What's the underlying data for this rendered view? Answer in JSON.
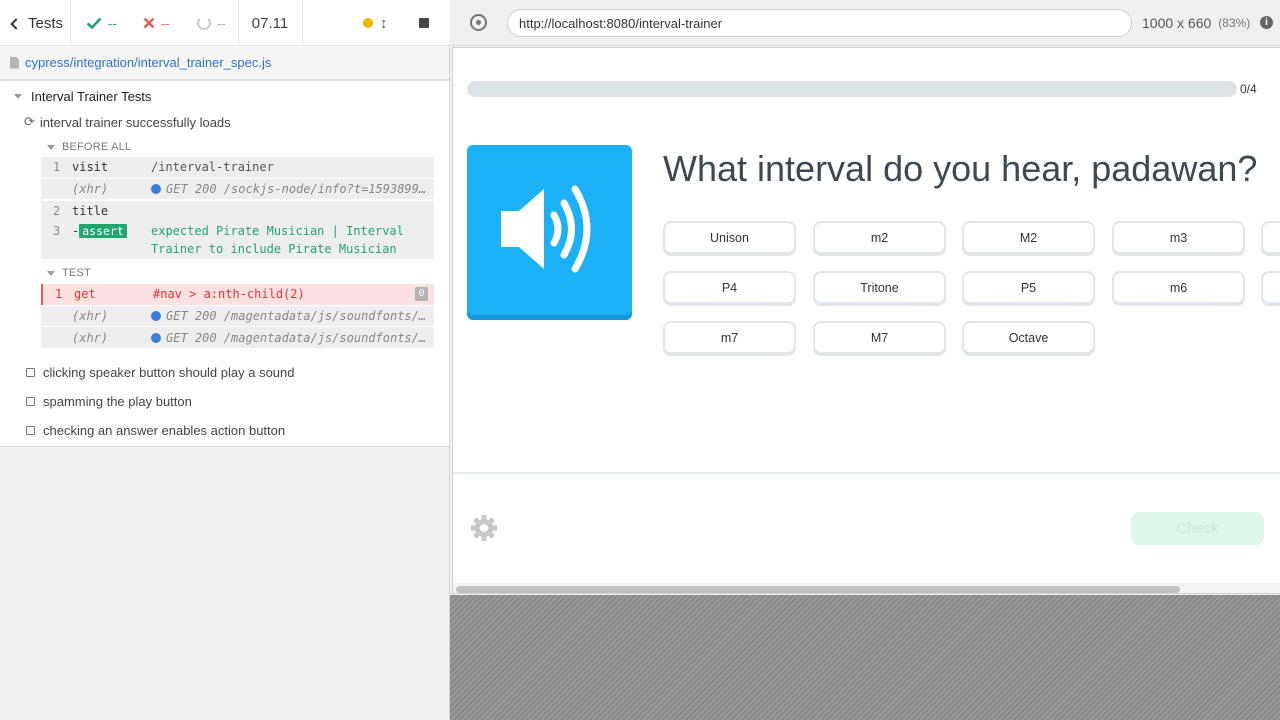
{
  "stats": {
    "tests_label": "Tests",
    "passed": "--",
    "failed": "--",
    "pending": "--",
    "duration": "07.11"
  },
  "spec": {
    "path": "cypress/integration/interval_trainer_spec.js"
  },
  "suite": {
    "title": "Interval Trainer Tests",
    "tests": [
      {
        "title": "interval trainer successfully loads",
        "state": "running"
      },
      {
        "title": "clicking speaker button should play a sound",
        "state": "pending"
      },
      {
        "title": "spamming the play button",
        "state": "pending"
      },
      {
        "title": "checking an answer enables action button",
        "state": "pending"
      }
    ],
    "before_all_label": "BEFORE ALL",
    "test_label": "TEST"
  },
  "commands": {
    "before_all": [
      {
        "num": "1",
        "name": "visit",
        "message": "/interval-trainer"
      },
      {
        "num": "",
        "name": "(xhr)",
        "message": "GET 200 /sockjs-node/info?t=1593899..."
      },
      {
        "num": "2",
        "name": "title",
        "message": ""
      },
      {
        "num": "3",
        "name": "-assert",
        "badge": "assert",
        "message": "expected  Pirate Musician | Interval",
        "message2": "Trainer  to include  Pirate Musician"
      }
    ],
    "test": [
      {
        "num": "1",
        "name": "get",
        "message": "#nav > a:nth-child(2)",
        "count": "0"
      },
      {
        "num": "",
        "name": "(xhr)",
        "message": "GET 200 /magentadata/js/soundfonts/..."
      },
      {
        "num": "",
        "name": "(xhr)",
        "message": "GET 200 /magentadata/js/soundfonts/..."
      }
    ]
  },
  "aut": {
    "url": "http://localhost:8080/interval-trainer",
    "viewport": "1000 x 660",
    "scale": "(83%)",
    "progress_label": "0/4",
    "progress_value": 0,
    "question": "What interval do you hear, padawan?",
    "answers": [
      "Unison",
      "m2",
      "M2",
      "m3",
      "P4",
      "Tritone",
      "P5",
      "m6",
      "m7",
      "M7",
      "Octave"
    ],
    "check_label": "Check"
  },
  "colors": {
    "speaker": "#1cb0f6",
    "passed": "#1fa66d",
    "failed": "#e45a57",
    "running_dot": "#f5b400",
    "check_disabled": "#dff8ea"
  },
  "icons": [
    "chevron-left-icon",
    "checkmark-icon",
    "x-icon",
    "spinner-icon",
    "arrows-vertical-icon",
    "stop-icon",
    "file-icon",
    "crosshair-icon",
    "info-icon",
    "speaker-icon",
    "gear-icon"
  ]
}
